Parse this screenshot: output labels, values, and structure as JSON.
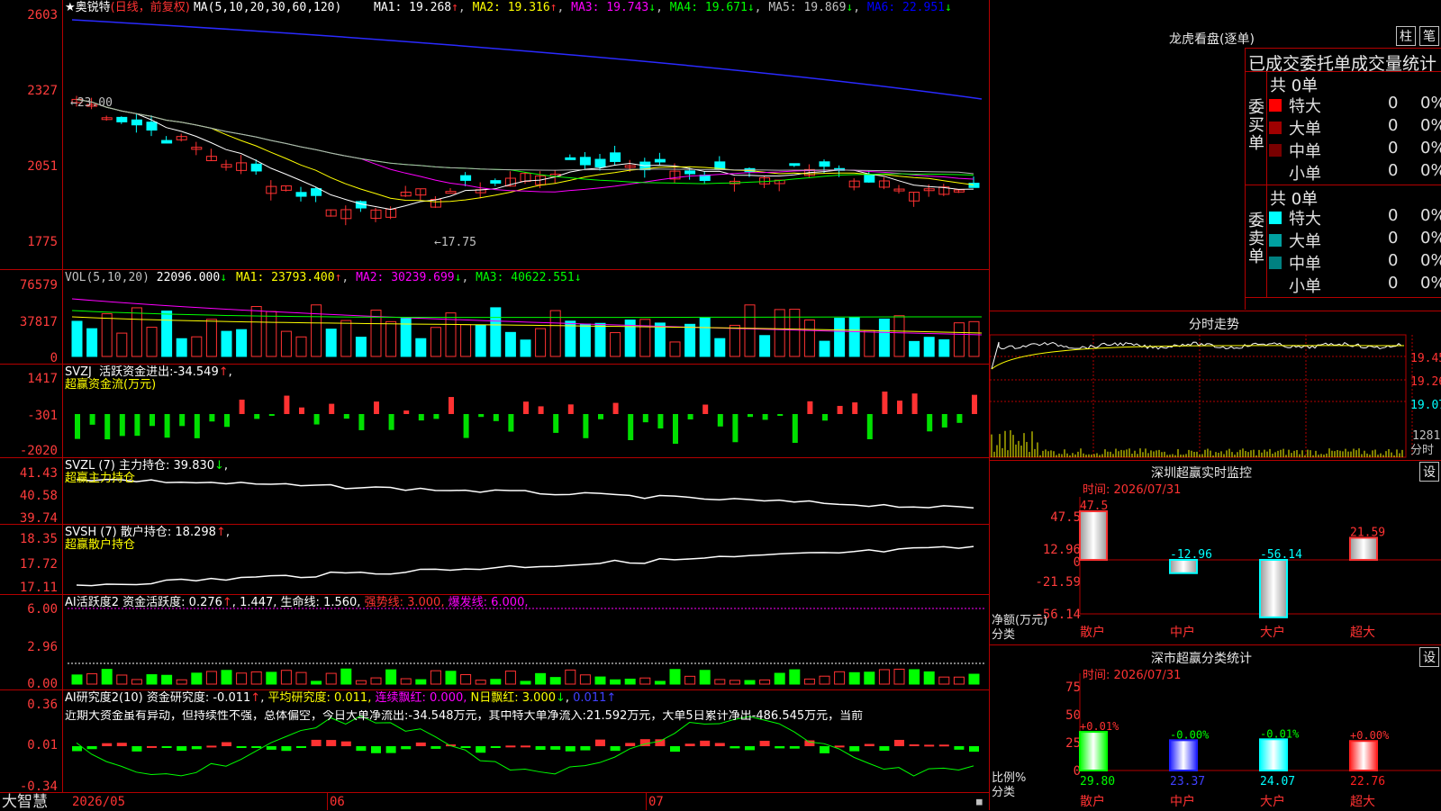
{
  "stock": {
    "name": "奥锐特",
    "mode": "(日线，前复权)"
  },
  "colors": {
    "bg": "#000000",
    "grid": "#b40000",
    "up": "#ff3232",
    "down": "#00ffff",
    "text": "#c0c0c0",
    "white": "#ffffff",
    "yellow": "#ffff00",
    "magenta": "#ff00ff",
    "green": "#00ff00",
    "blue": "#0000ff"
  },
  "main": {
    "ma_label": "MA(5,10,20,30,60,120)",
    "indicators": [
      {
        "label": "MA1:",
        "value": "19.268",
        "arrow": "↑",
        "color": "#ffffff"
      },
      {
        "label": "MA2:",
        "value": "19.316",
        "arrow": "↑",
        "color": "#ffff00"
      },
      {
        "label": "MA3:",
        "value": "19.743",
        "arrow": "↓",
        "color": "#ff00ff"
      },
      {
        "label": "MA4:",
        "value": "19.671",
        "arrow": "↓",
        "color": "#00ff00"
      },
      {
        "label": "MA5:",
        "value": "19.869",
        "arrow": "↓",
        "color": "#c0c0c0"
      },
      {
        "label": "MA6:",
        "value": "22.951",
        "arrow": "↓",
        "color": "#0000ff"
      }
    ],
    "y_ticks": [
      "2603",
      "2327",
      "2051",
      "1775"
    ],
    "high_label": "←23.00",
    "low_label": "←17.75"
  },
  "volume": {
    "label": "VOL(5,10,20)",
    "value": "22096.000",
    "value_arrow": "↓",
    "indicators": [
      {
        "label": "MA1:",
        "value": "23793.400",
        "arrow": "↑",
        "color": "#ffff00"
      },
      {
        "label": "MA2:",
        "value": "30239.699",
        "arrow": "↓",
        "color": "#ff00ff"
      },
      {
        "label": "MA3:",
        "value": "40622.551",
        "arrow": "↓",
        "color": "#00ff00"
      }
    ],
    "y_ticks": [
      "76579",
      "37817",
      "0"
    ]
  },
  "svzj": {
    "label": "SVZJ",
    "title": "活跃资金进出:",
    "value": "-34.549",
    "arrow": "↑",
    "subtitle": "超赢资金流(万元)",
    "y_ticks": [
      "1417",
      "-301",
      "-2020"
    ]
  },
  "svzl": {
    "label": "SVZL (7)",
    "title": "主力持仓:",
    "value": "39.830",
    "arrow": "↓",
    "subtitle": "超赢主力持仓",
    "y_ticks": [
      "41.43",
      "40.58",
      "39.74"
    ]
  },
  "svsh": {
    "label": "SVSH (7)",
    "title": "散户持仓:",
    "value": "18.298",
    "arrow": "↑",
    "subtitle": "超赢散户持仓",
    "y_ticks": [
      "18.35",
      "17.72",
      "17.11"
    ]
  },
  "ai1": {
    "label": "AI活跃度2",
    "title": "资金活跃度:",
    "value": "0.276",
    "arrow": "↑",
    "value2": "1.447",
    "life_label": "生命线:",
    "life_value": "1.560",
    "strong_label": "强势线:",
    "strong_value": "3.000",
    "burst_label": "爆发线:",
    "burst_value": "6.000",
    "y_ticks": [
      "6.00",
      "2.96",
      "0.00"
    ]
  },
  "ai2": {
    "label": "AI研究度2(10)",
    "title": "资金研究度:",
    "value": "-0.011",
    "arrow": "↑",
    "avg_label": "平均研究度:",
    "avg_value": "0.011",
    "lx_label": "连续飘红:",
    "lx_value": "0.000",
    "nday_label": "N日飘红:",
    "nday_value": "3.000",
    "nday_arrow": "↓",
    "last_value": "0.011",
    "last_arrow": "↑",
    "note": "近期大资金虽有异动，但持续性不强，总体偏空，今日大单净流出:-34.548万元，其中特大单净流入:21.592万元，大单5日累计净出-486.545万元，当前",
    "y_ticks": [
      "0.36",
      "0.01",
      "-0.34"
    ]
  },
  "timeline": {
    "brand": "大智慧",
    "labels": [
      "2026/05",
      "06",
      "07"
    ]
  },
  "longhu": {
    "title": "龙虎看盘(逐单)",
    "btn1": "柱",
    "btn2": "笔",
    "subtitle": "已成交委托单成交量统计",
    "buy": {
      "side": "委买单",
      "total": "共 0单",
      "rows": [
        {
          "name": "特大",
          "value": "0",
          "pct": "0%",
          "color": "#ff0000"
        },
        {
          "name": "大单",
          "value": "0",
          "pct": "0%",
          "color": "#a00000"
        },
        {
          "name": "中单",
          "value": "0",
          "pct": "0%",
          "color": "#780000"
        },
        {
          "name": "小单",
          "value": "0",
          "pct": "0%",
          "color": "#000000"
        }
      ]
    },
    "sell": {
      "side": "委卖单",
      "total": "共 0单",
      "rows": [
        {
          "name": "特大",
          "value": "0",
          "pct": "0%",
          "color": "#00ffff"
        },
        {
          "name": "大单",
          "value": "0",
          "pct": "0%",
          "color": "#00a0a0"
        },
        {
          "name": "中单",
          "value": "0",
          "pct": "0%",
          "color": "#008080"
        },
        {
          "name": "小单",
          "value": "0",
          "pct": "0%",
          "color": "#000000"
        }
      ]
    }
  },
  "intraday": {
    "title": "分时走势",
    "prices": [
      "19.45",
      "19.26",
      "19.07"
    ],
    "volume": "1281",
    "vol_label": "分时"
  },
  "monitor": {
    "title": "深圳超赢实时监控",
    "btn": "设",
    "time": "时间: 2026/07/31",
    "y_ticks": [
      "47.5",
      "12.96",
      "0",
      "-21.59",
      "-56.14"
    ],
    "unit_label": "净额(万元)",
    "category_label": "分类",
    "bars": [
      {
        "name": "散户",
        "value": 47.5,
        "label": "47.5"
      },
      {
        "name": "中户",
        "value": -12.96,
        "label": "-12.96"
      },
      {
        "name": "大户",
        "value": -56.14,
        "label": "-56.14"
      },
      {
        "name": "超大",
        "value": 21.59,
        "label": "21.59"
      }
    ]
  },
  "classify": {
    "title": "深市超赢分类统计",
    "btn": "设",
    "time": "时间: 2026/07/31",
    "y_ticks": [
      "75",
      "50",
      "25",
      "0"
    ],
    "ratio_label": "比例%",
    "category_label": "分类",
    "bars": [
      {
        "name": "散户",
        "pct": 29.8,
        "pct_label": "29.80",
        "change": "+0.01%",
        "color": "#00ff00"
      },
      {
        "name": "中户",
        "pct": 23.37,
        "pct_label": "23.37",
        "change": "-0.00%",
        "color": "#2020ff"
      },
      {
        "name": "大户",
        "pct": 24.07,
        "pct_label": "24.07",
        "change": "-0.01%",
        "color": "#00ffff"
      },
      {
        "name": "超大",
        "pct": 22.76,
        "pct_label": "22.76",
        "change": "+0.00%",
        "color": "#ff2020"
      }
    ]
  }
}
